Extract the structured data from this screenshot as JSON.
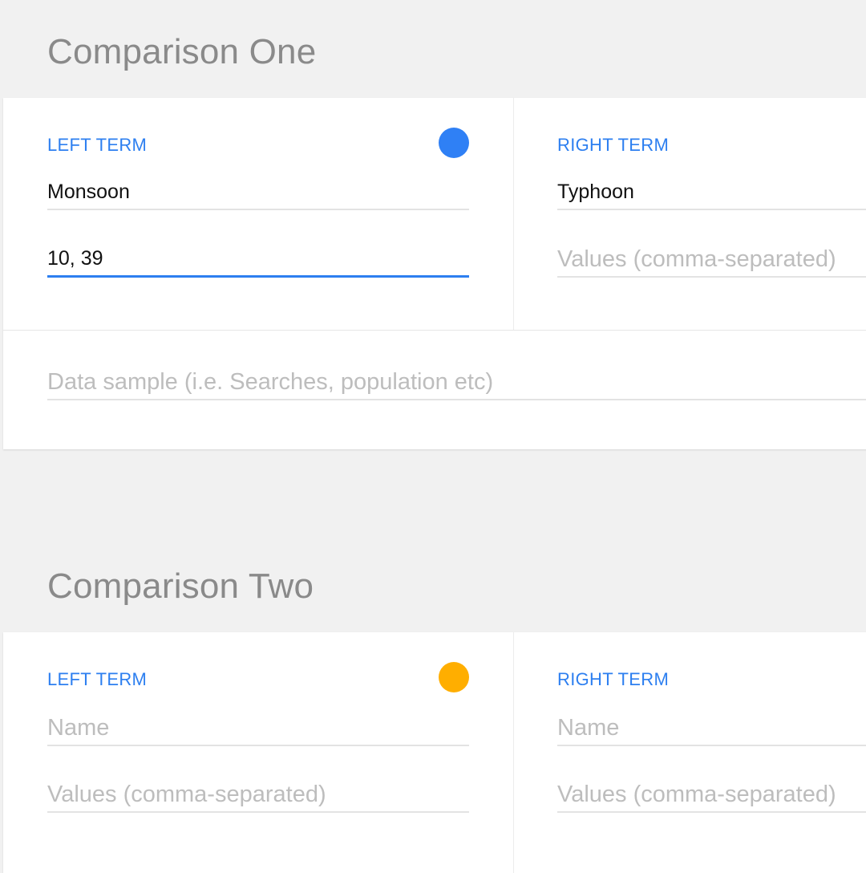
{
  "comparison_one": {
    "title": "Comparison One",
    "dot_color": "#2f80f5",
    "left": {
      "label": "LEFT TERM",
      "name_value": "Monsoon",
      "values_value": "10, 39"
    },
    "right": {
      "label": "RIGHT TERM",
      "name_value": "Typhoon",
      "values_placeholder": "Values (comma-separated)"
    },
    "sample_placeholder": "Data sample (i.e. Searches, population etc)"
  },
  "comparison_two": {
    "title": "Comparison Two",
    "dot_color": "#ffae00",
    "left": {
      "label": "LEFT TERM",
      "name_placeholder": "Name",
      "values_placeholder": "Values (comma-separated)"
    },
    "right": {
      "label": "RIGHT TERM",
      "name_placeholder": "Name",
      "values_placeholder": "Values (comma-separated)"
    }
  }
}
